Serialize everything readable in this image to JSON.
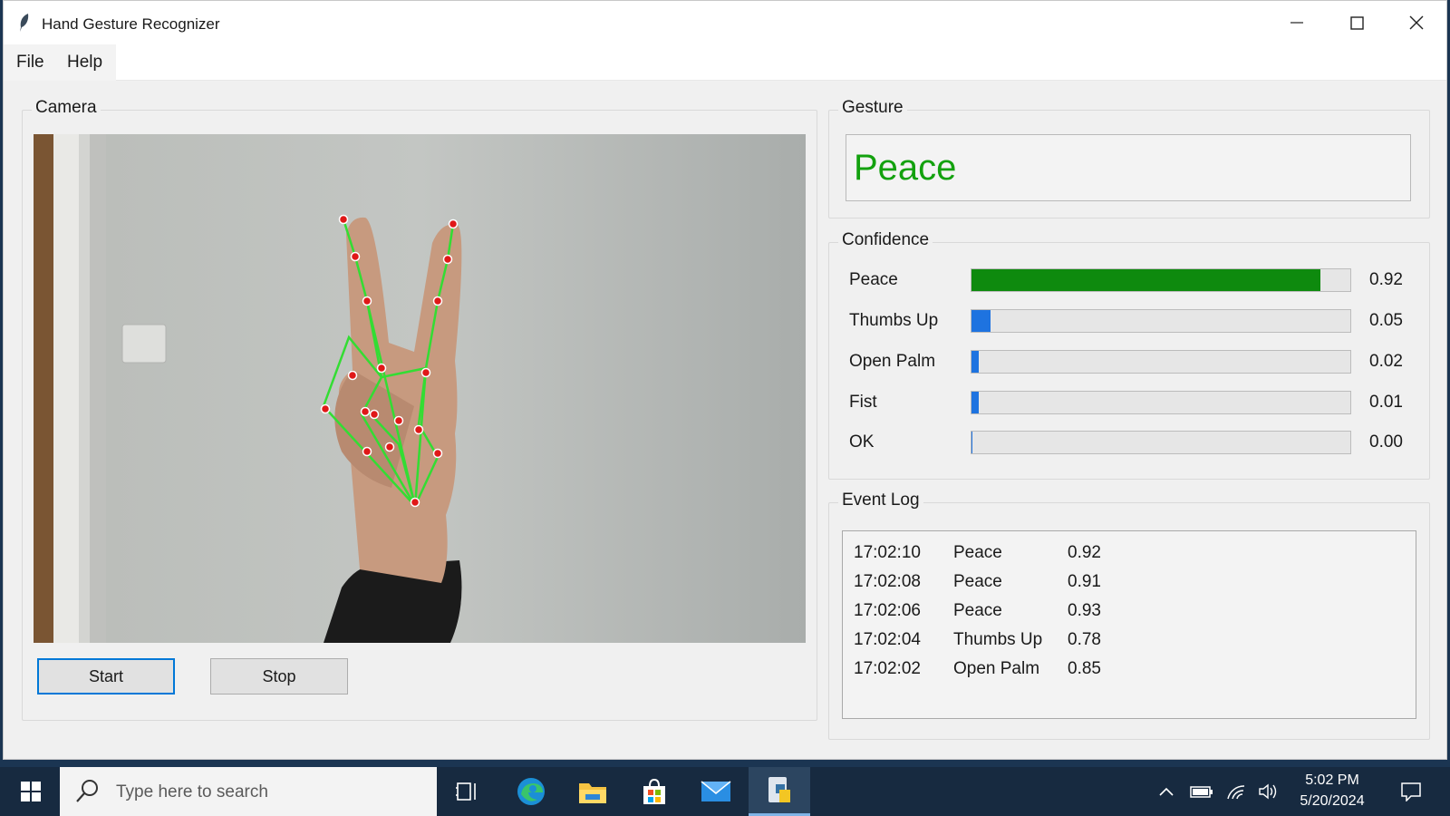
{
  "window": {
    "title": "Hand Gesture Recognizer",
    "icon": "feather-icon"
  },
  "menu": {
    "items": [
      {
        "label": "File"
      },
      {
        "label": "Help"
      }
    ]
  },
  "camera": {
    "group_label": "Camera",
    "start_label": "Start",
    "stop_label": "Stop"
  },
  "gesture": {
    "group_label": "Gesture",
    "value": "Peace",
    "color": "#13a10e"
  },
  "confidence": {
    "group_label": "Confidence",
    "items": [
      {
        "label": "Peace",
        "value": "0.92",
        "fraction": 0.92,
        "color": "#0e8a0e"
      },
      {
        "label": "Thumbs Up",
        "value": "0.05",
        "fraction": 0.05,
        "color": "#1e73e0"
      },
      {
        "label": "Open Palm",
        "value": "0.02",
        "fraction": 0.02,
        "color": "#1e73e0"
      },
      {
        "label": "Fist",
        "value": "0.01",
        "fraction": 0.01,
        "color": "#1e73e0"
      },
      {
        "label": "OK",
        "value": "0.00",
        "fraction": 0.0,
        "color": "#1e73e0"
      }
    ]
  },
  "event_log": {
    "group_label": "Event Log",
    "rows": [
      {
        "time": "17:02:10",
        "gesture": "Peace",
        "score": "0.92"
      },
      {
        "time": "17:02:08",
        "gesture": "Peace",
        "score": "0.91"
      },
      {
        "time": "17:02:06",
        "gesture": "Peace",
        "score": "0.93"
      },
      {
        "time": "17:02:04",
        "gesture": "Thumbs Up",
        "score": "0.78"
      },
      {
        "time": "17:02:02",
        "gesture": "Open Palm",
        "score": "0.85"
      }
    ]
  },
  "taskbar": {
    "search_placeholder": "Type here to search",
    "time": "5:02 PM",
    "date": "5/20/2024"
  }
}
